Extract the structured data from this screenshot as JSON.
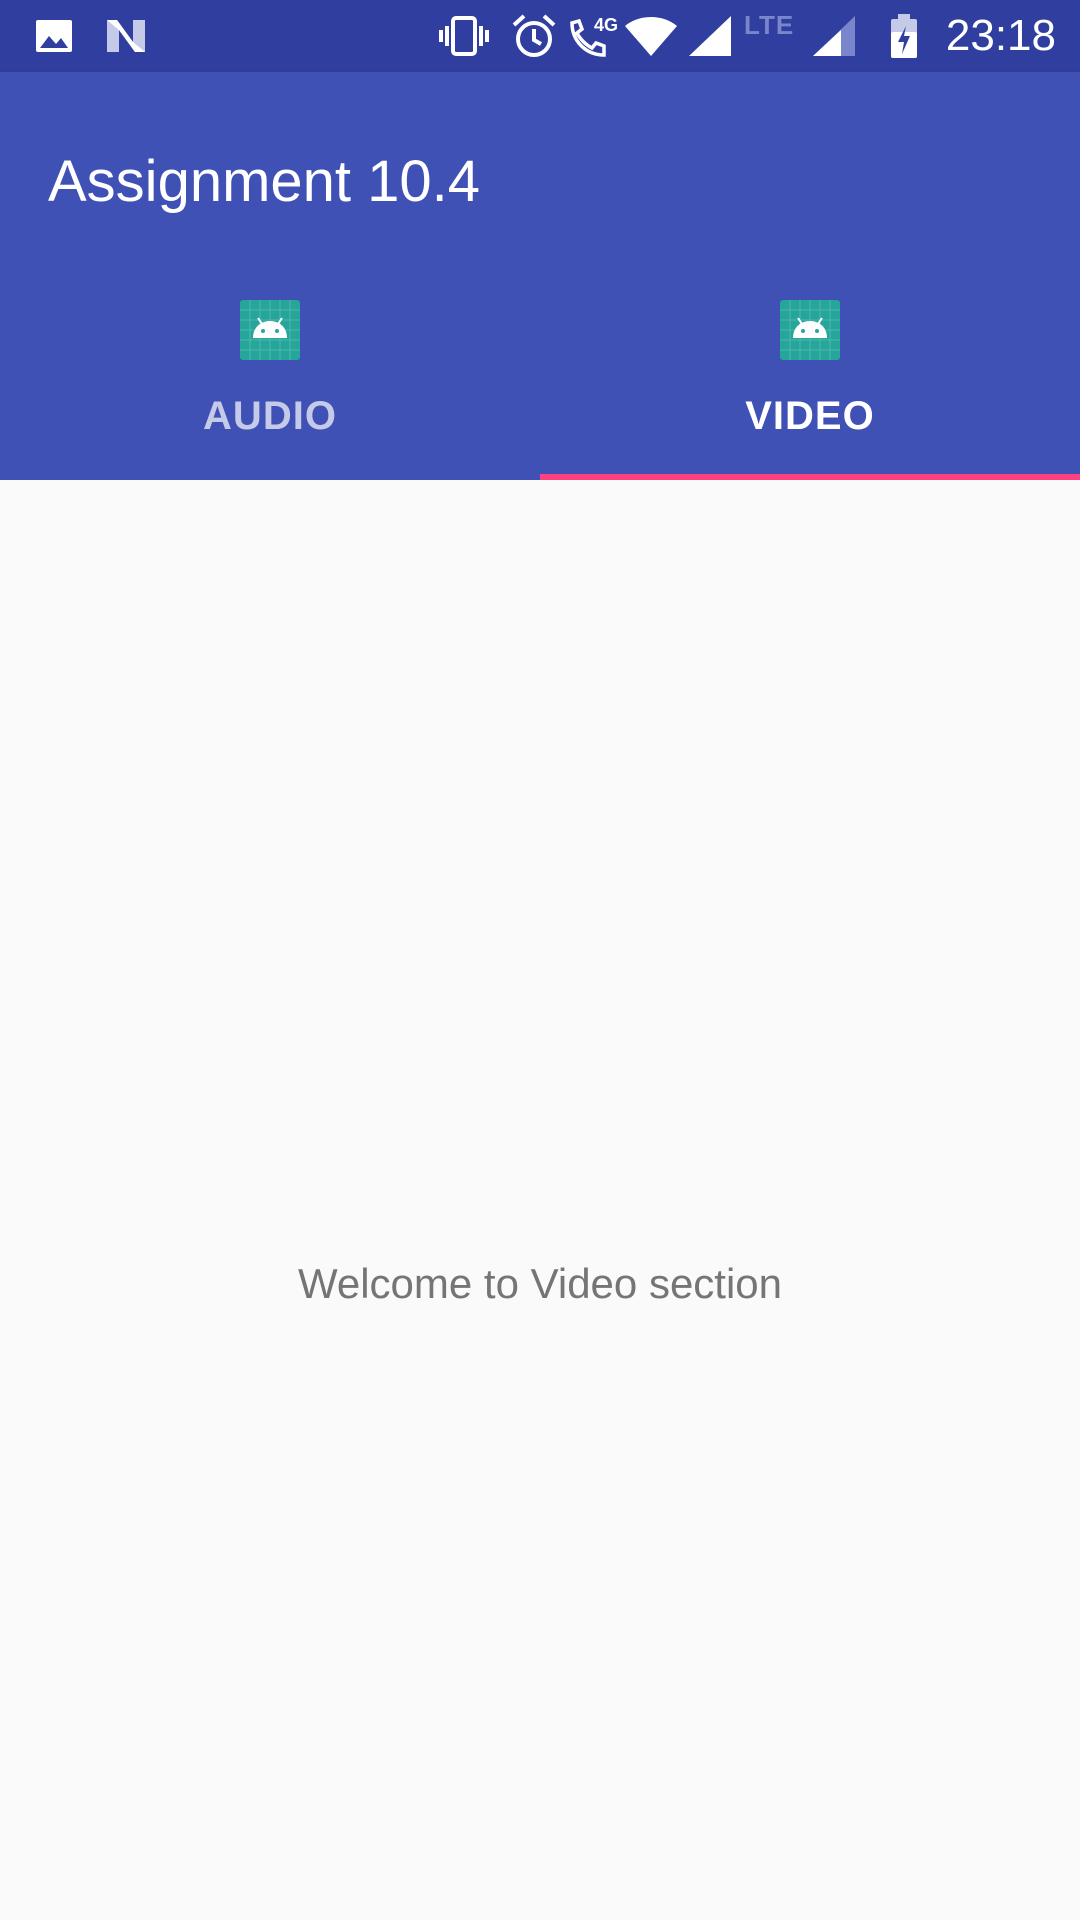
{
  "status_bar": {
    "time": "23:18",
    "network_label": "LTE",
    "icons": [
      "image-icon",
      "n-logo-icon",
      "vibrate-icon",
      "alarm-icon",
      "volte-4g-call-icon",
      "wifi-icon",
      "cell-signal-icon",
      "lte-signal-icon",
      "battery-charging-icon"
    ]
  },
  "app_bar": {
    "title": "Assignment 10.4"
  },
  "tabs": [
    {
      "label": "AUDIO",
      "icon": "android-icon",
      "selected": false
    },
    {
      "label": "VIDEO",
      "icon": "android-icon",
      "selected": true
    }
  ],
  "content": {
    "message": "Welcome to Video section"
  },
  "colors": {
    "status_bar": "#303f9f",
    "primary": "#3f51b5",
    "accent_indicator": "#ff4081",
    "icon_teal": "#26a69a",
    "background": "#fafafa",
    "message_text": "#757575"
  }
}
